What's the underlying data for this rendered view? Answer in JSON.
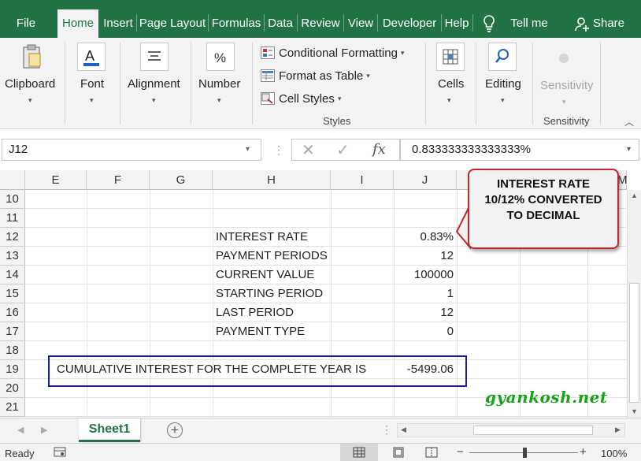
{
  "tabs": [
    {
      "label": "File"
    },
    {
      "label": "Home"
    },
    {
      "label": "Insert"
    },
    {
      "label": "Page Layout"
    },
    {
      "label": "Formulas"
    },
    {
      "label": "Data"
    },
    {
      "label": "Review"
    },
    {
      "label": "View"
    },
    {
      "label": "Developer"
    },
    {
      "label": "Help"
    }
  ],
  "tell_me": "Tell me",
  "share": "Share",
  "ribbon": {
    "clipboard": "Clipboard",
    "font": "Font",
    "alignment": "Alignment",
    "number": "Number",
    "conditional_formatting": "Conditional Formatting",
    "format_as_table": "Format as Table",
    "cell_styles": "Cell Styles",
    "styles_group": "Styles",
    "cells": "Cells",
    "editing": "Editing",
    "sensitivity": "Sensitivity",
    "sensitivity_group": "Sensitivity"
  },
  "formula_bar": {
    "name_box": "J12",
    "fx": "fx",
    "value": "0.833333333333333%"
  },
  "columns": [
    "E",
    "F",
    "G",
    "H",
    "I",
    "J",
    "M"
  ],
  "rows": [
    "10",
    "11",
    "12",
    "13",
    "14",
    "15",
    "16",
    "17",
    "18",
    "19",
    "20",
    "21"
  ],
  "cells": {
    "h12": "INTEREST RATE",
    "j12": "0.83%",
    "h13": "PAYMENT PERIODS",
    "j13": "12",
    "h14": "CURRENT VALUE",
    "j14": "100000",
    "h15": "STARTING PERIOD",
    "j15": "1",
    "h16": "LAST PERIOD",
    "j16": "12",
    "h17": "PAYMENT TYPE",
    "j17": "0",
    "e19": "CUMULATIVE INTEREST FOR THE COMPLETE YEAR IS",
    "j19": "-5499.06"
  },
  "callout": {
    "line1": "INTEREST RATE",
    "line2": "10/12% CONVERTED",
    "line3": "TO DECIMAL"
  },
  "watermark": "gyankosh.net",
  "sheet_tab": "Sheet1",
  "status": {
    "ready": "Ready",
    "zoom": "100%"
  },
  "colors": {
    "excel_green": "#217346",
    "callout_border": "#c0282e",
    "box_blue": "#1a1aa8",
    "watermark_green": "#19a319"
  }
}
